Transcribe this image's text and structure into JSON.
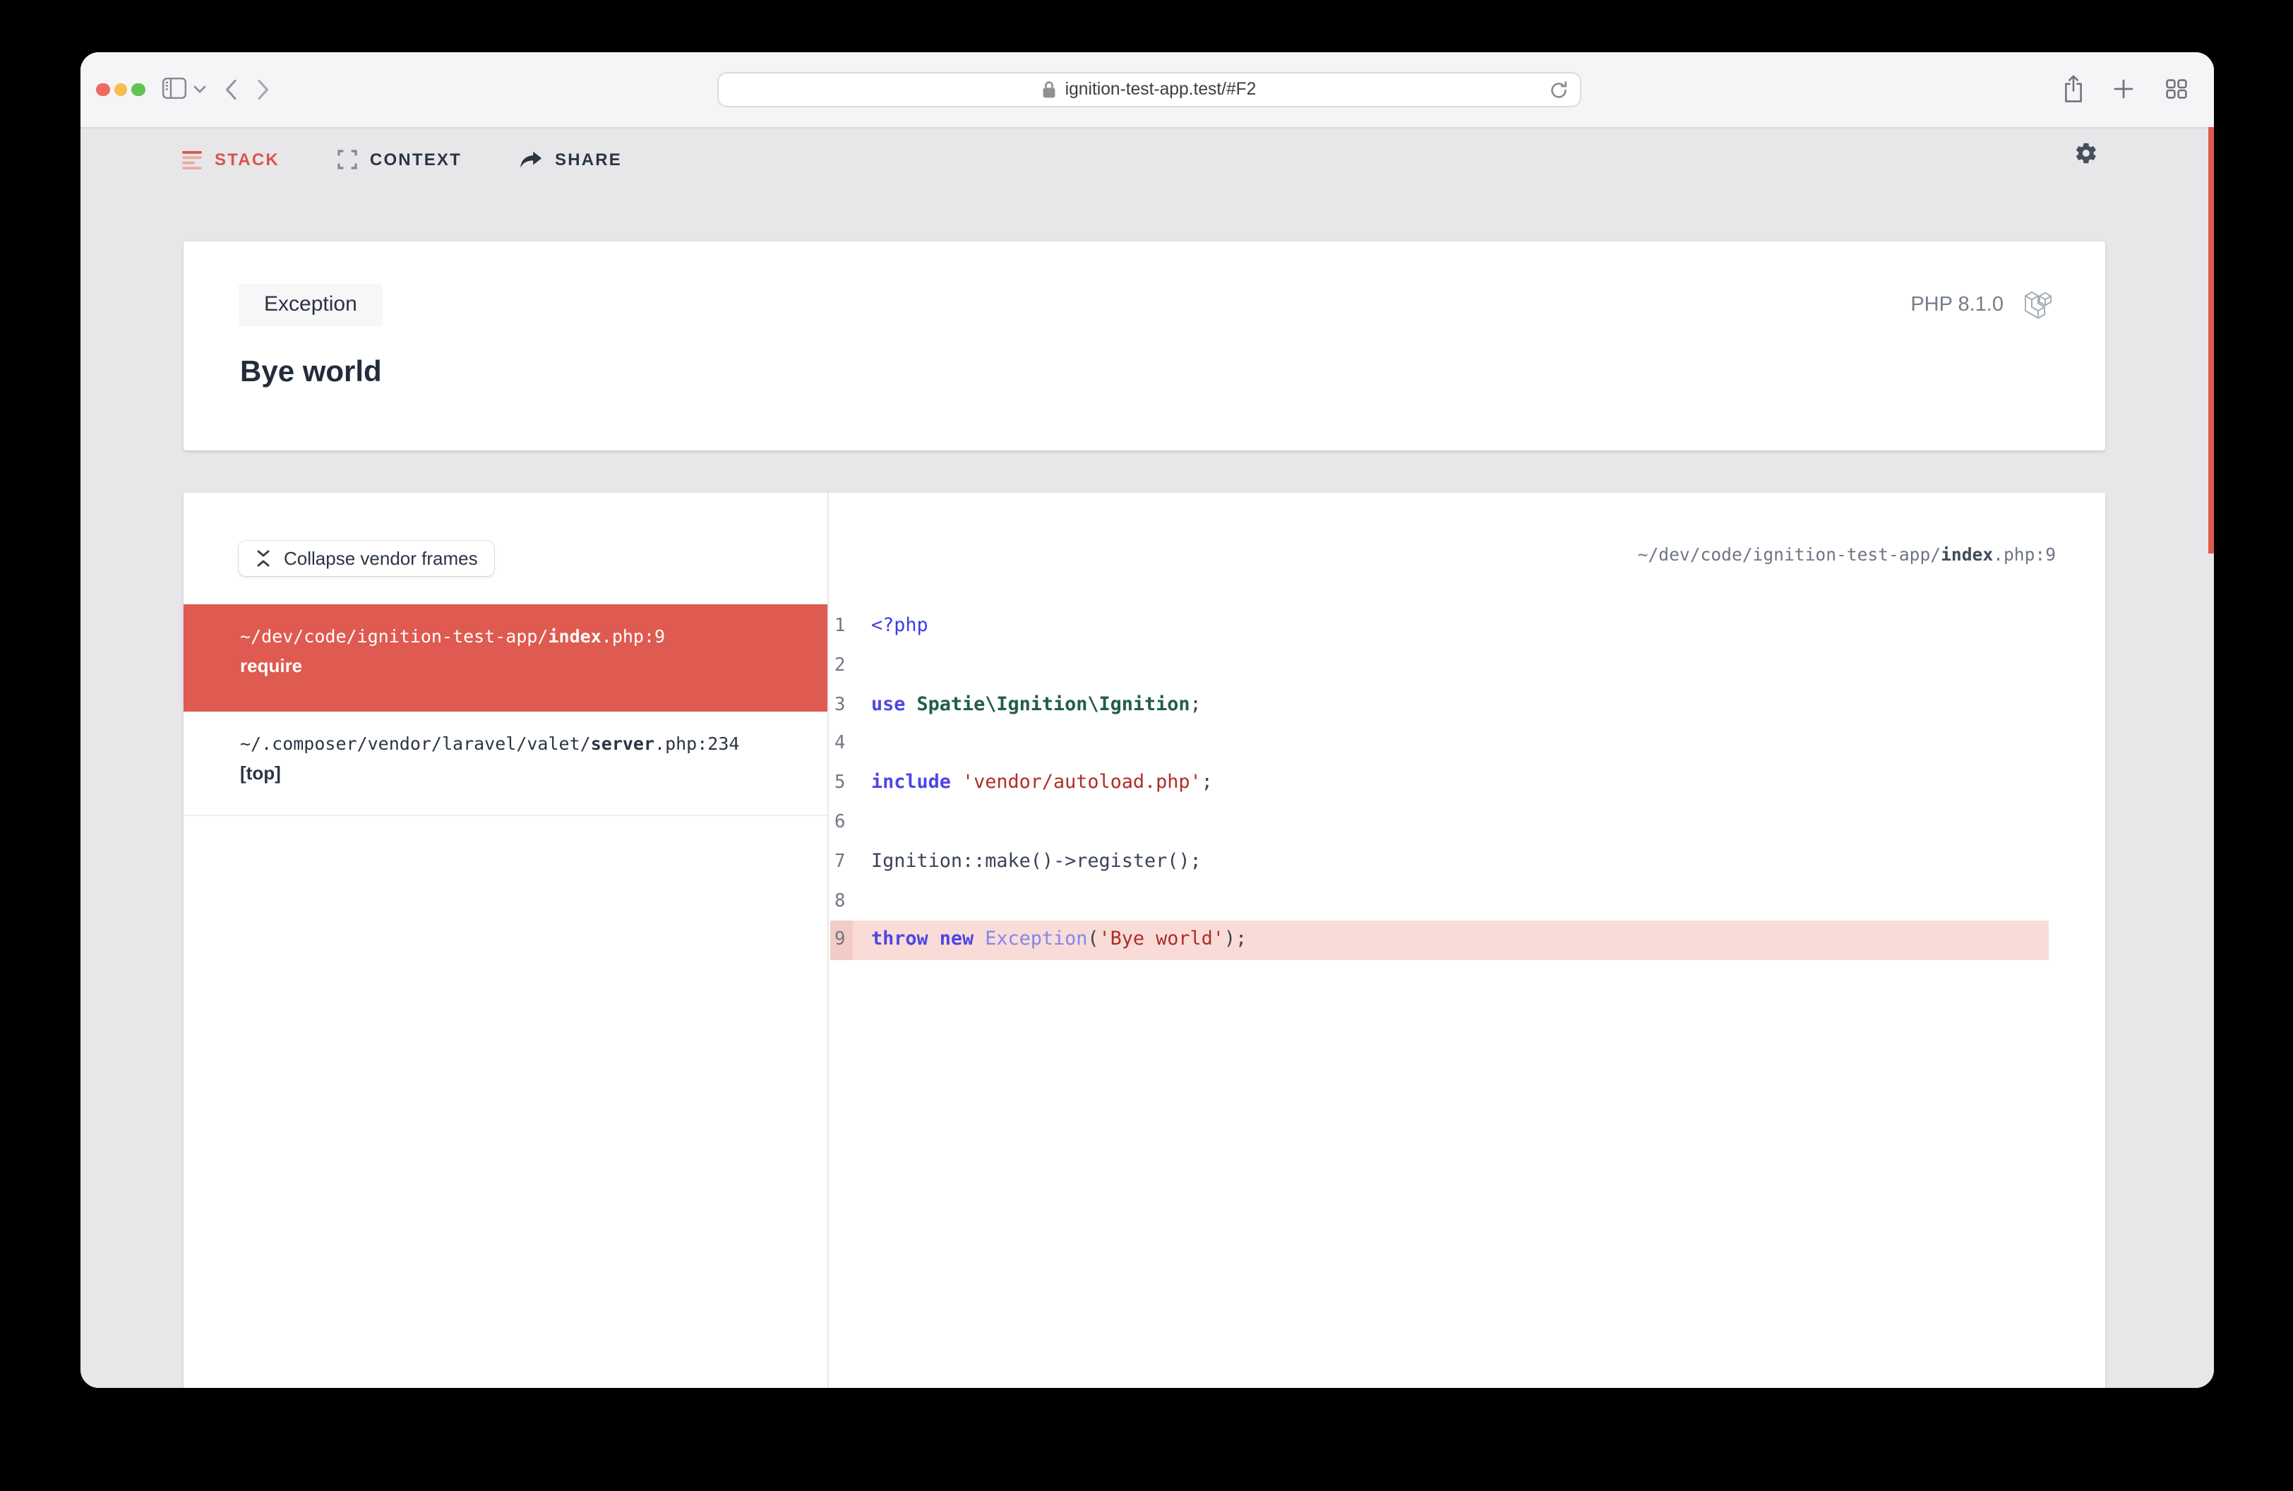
{
  "browser": {
    "url": "ignition-test-app.test/#F2",
    "window_controls": [
      "close",
      "minimize",
      "zoom"
    ]
  },
  "nav": {
    "items": [
      {
        "label": "STACK",
        "active": true
      },
      {
        "label": "CONTEXT",
        "active": false
      },
      {
        "label": "SHARE",
        "active": false
      }
    ]
  },
  "exception": {
    "badge": "Exception",
    "message": "Bye world",
    "php_version": "PHP 8.1.0"
  },
  "stack_panel": {
    "collapse_button": "Collapse vendor frames",
    "frames": [
      {
        "prefix": "~/dev/code/ignition-test-app/",
        "file": "index",
        "suffix": ".php:9",
        "method": "require",
        "selected": true
      },
      {
        "prefix": "~/.composer/vendor/laravel/valet/",
        "file": "server",
        "suffix": ".php:234",
        "method": "[top]",
        "selected": false
      }
    ]
  },
  "code_panel": {
    "path": {
      "prefix": "~/dev/code/ignition-test-app/",
      "file": "index",
      "suffix": ".php:9"
    },
    "highlight_line": 9,
    "lines": [
      {
        "n": 1,
        "tokens": [
          {
            "t": "<?php",
            "s": "tag"
          }
        ]
      },
      {
        "n": 2,
        "tokens": []
      },
      {
        "n": 3,
        "tokens": [
          {
            "t": "use",
            "s": "kw"
          },
          {
            "t": " ",
            "s": "plain"
          },
          {
            "t": "Spatie\\Ignition\\Ignition",
            "s": "cls"
          },
          {
            "t": ";",
            "s": "plain"
          }
        ]
      },
      {
        "n": 4,
        "tokens": []
      },
      {
        "n": 5,
        "tokens": [
          {
            "t": "include",
            "s": "kw"
          },
          {
            "t": " ",
            "s": "plain"
          },
          {
            "t": "'vendor/autoload.php'",
            "s": "str"
          },
          {
            "t": ";",
            "s": "plain"
          }
        ]
      },
      {
        "n": 6,
        "tokens": []
      },
      {
        "n": 7,
        "tokens": [
          {
            "t": "Ignition::make()->register();",
            "s": "plain"
          }
        ]
      },
      {
        "n": 8,
        "tokens": []
      },
      {
        "n": 9,
        "tokens": [
          {
            "t": "throw",
            "s": "kw"
          },
          {
            "t": " ",
            "s": "plain"
          },
          {
            "t": "new",
            "s": "kw"
          },
          {
            "t": " ",
            "s": "plain"
          },
          {
            "t": "Exception",
            "s": "cls2"
          },
          {
            "t": "(",
            "s": "plain"
          },
          {
            "t": "'Bye world'",
            "s": "str"
          },
          {
            "t": ");",
            "s": "plain"
          }
        ]
      }
    ]
  },
  "colors": {
    "accent_red": "#DF5A50",
    "highlight_row": "#F9DCD8",
    "highlight_gutter": "#F2CCC6",
    "page_bg": "#E7E7EA"
  }
}
